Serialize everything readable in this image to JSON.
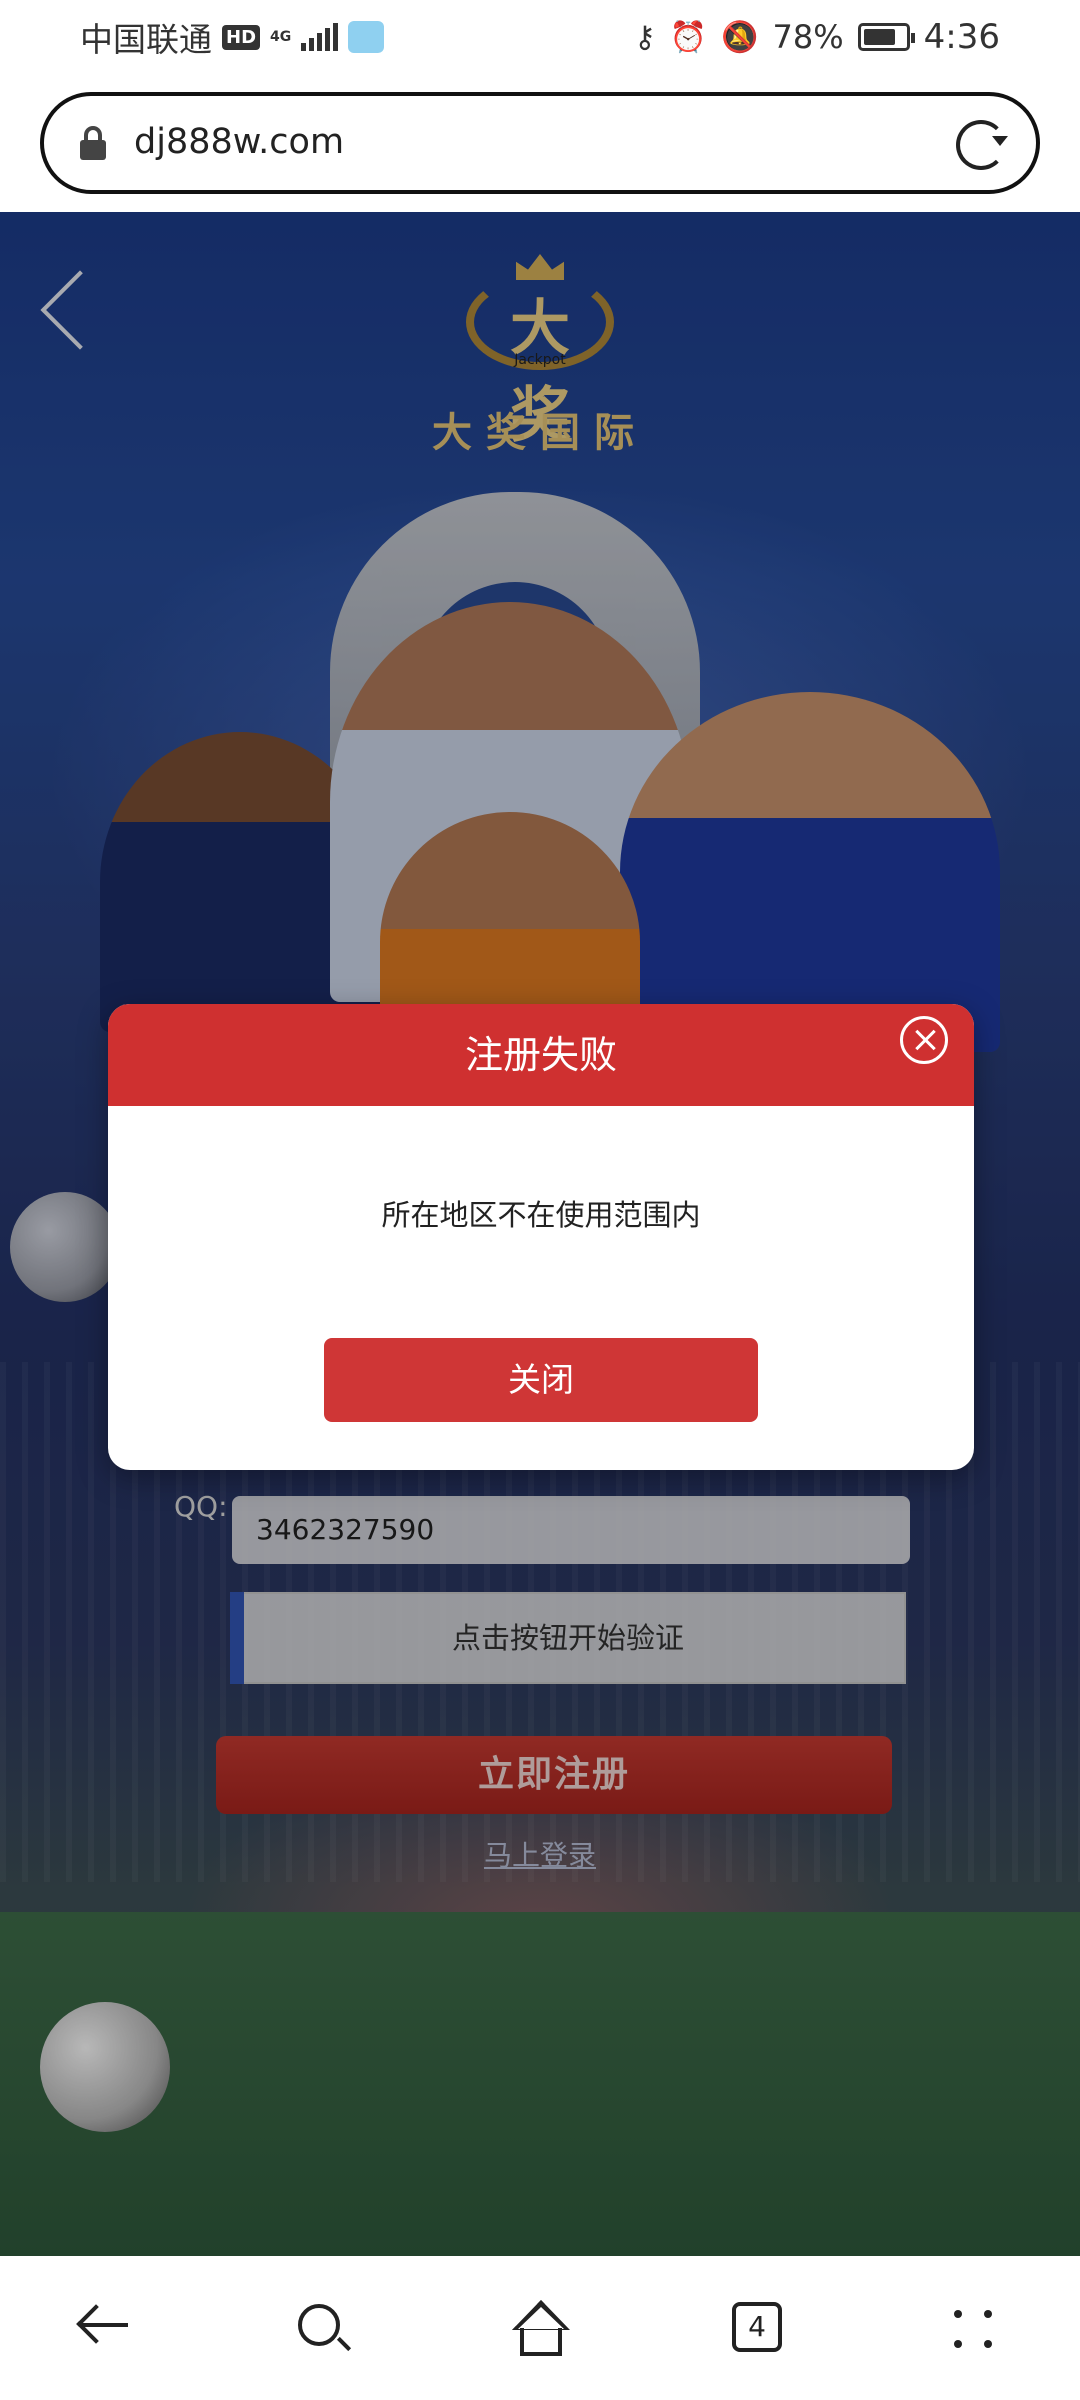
{
  "status_bar": {
    "carrier": "中国联通",
    "hd_badge": "HD",
    "network": "4G",
    "battery_percent": "78%",
    "battery_level": 0.78,
    "time": "4:36",
    "icons": [
      "key-icon",
      "alarm-icon",
      "mute-icon",
      "battery-icon"
    ]
  },
  "browser": {
    "url": "dj888w.com",
    "tab_count": "4"
  },
  "page": {
    "brand_name": "大奖国际",
    "logo_mark": "大奖",
    "logo_sub": "Jackpot",
    "qq_label": "QQ:",
    "qq_value": "3462327590",
    "verify_label": "点击按钮开始验证",
    "register_button": "立即注册",
    "login_link": "马上登录"
  },
  "modal": {
    "title": "注册失败",
    "message": "所在地区不在使用范围内",
    "close_button": "关闭",
    "header_color": "#cf3030"
  }
}
